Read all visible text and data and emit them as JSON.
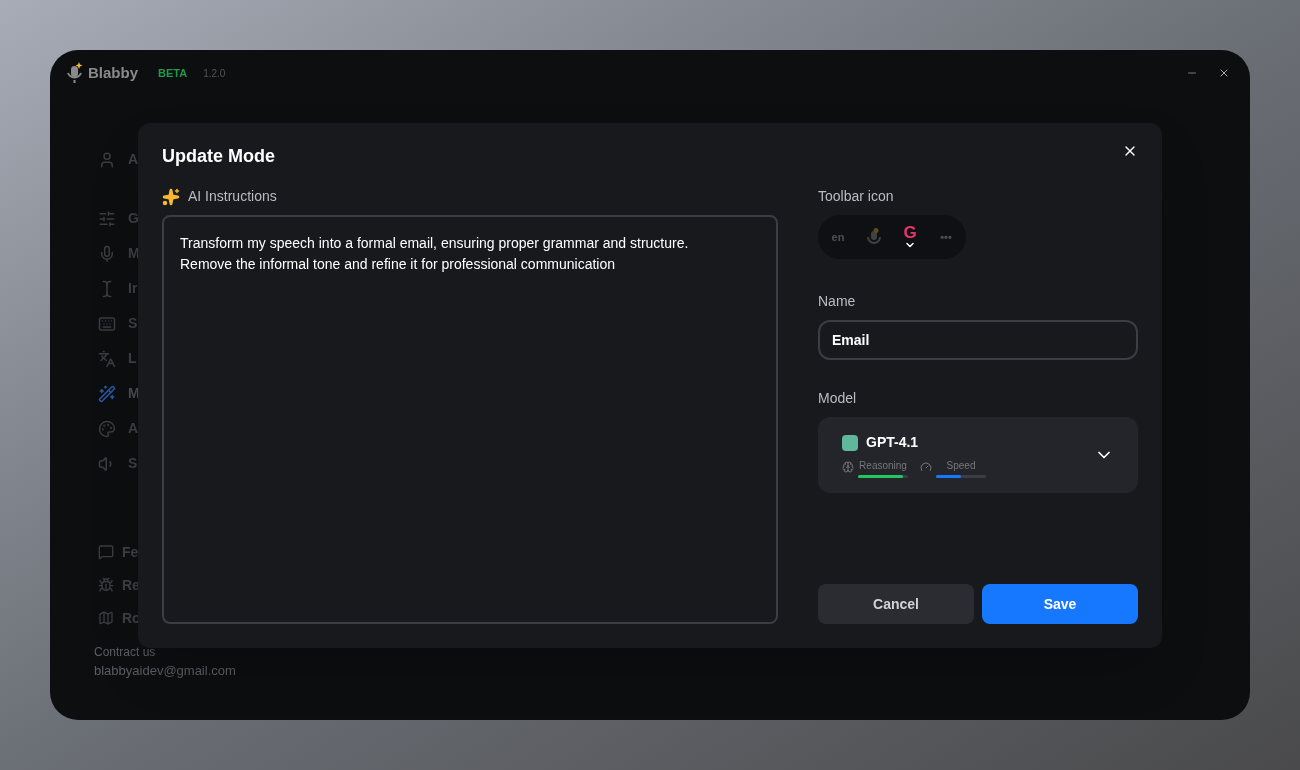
{
  "app": {
    "name": "Blabby",
    "badge": "BETA",
    "version": "1.2.0"
  },
  "sidebar": {
    "items": [
      {
        "label": "A",
        "selected": false
      },
      {
        "label": "G",
        "selected": false
      },
      {
        "label": "M",
        "selected": false
      },
      {
        "label": "Ir",
        "selected": false
      },
      {
        "label": "S",
        "selected": false
      },
      {
        "label": "L",
        "selected": false
      },
      {
        "label": "M",
        "selected": true
      },
      {
        "label": "A",
        "selected": false
      },
      {
        "label": "S",
        "selected": false
      }
    ],
    "footer_items": [
      {
        "label": "Fe"
      },
      {
        "label": "Re"
      },
      {
        "label": "Ro"
      }
    ],
    "contact_label": "Contract us",
    "contact_email": "blabbyaidev@gmail.com"
  },
  "dialog": {
    "title": "Update Mode",
    "instructions_label": "AI Instructions",
    "instructions": "Transform my speech into a formal email, ensuring proper grammar and structure.\nRemove the informal tone and refine it for professional communication",
    "toolbar_icon_label": "Toolbar icon",
    "toolbar_icons": [
      {
        "kind": "text",
        "text": "en",
        "selected": false
      },
      {
        "kind": "mic",
        "selected": false
      },
      {
        "kind": "g",
        "text": "G",
        "selected": true
      },
      {
        "kind": "text",
        "text": "•••",
        "selected": false
      }
    ],
    "name_label": "Name",
    "name_value": "Email",
    "model_label": "Model",
    "model": {
      "name": "GPT-4.1",
      "meters": [
        {
          "label": "Reasoning",
          "level": 0.9,
          "color": "#22c55e"
        },
        {
          "label": "Speed",
          "level": 0.5,
          "color": "#1677ff"
        }
      ]
    },
    "buttons": [
      {
        "kind": "secondary",
        "label": "Cancel"
      },
      {
        "kind": "primary",
        "label": "Save"
      }
    ]
  }
}
